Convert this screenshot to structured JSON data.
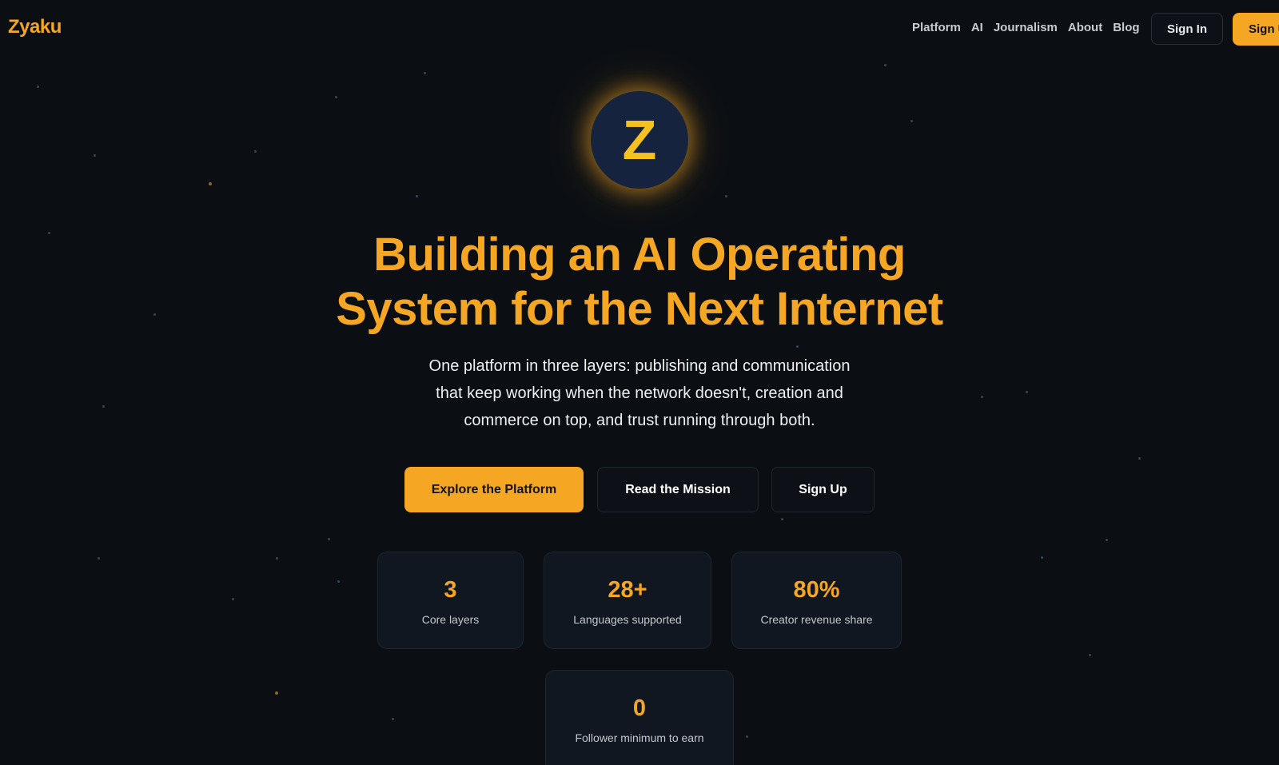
{
  "header": {
    "logo": "Zyaku",
    "nav": [
      "Platform",
      "AI",
      "Journalism",
      "About",
      "Blog"
    ],
    "sign_in": "Sign In",
    "sign_up": "Sign Up"
  },
  "hero": {
    "badge_letter": "Z",
    "title_line1": "Building an AI Operating",
    "title_line2": "System for the Next Internet",
    "subtitle_line1": "One platform in three layers: publishing and communication",
    "subtitle_line2": "that keep working when the network doesn't, creation and",
    "subtitle_line3": "commerce on top, and trust running through both."
  },
  "cta": {
    "primary": "Explore the Platform",
    "secondary": "Read the Mission",
    "tertiary": "Sign Up"
  },
  "stats": [
    {
      "value": "3",
      "label": "Core layers"
    },
    {
      "value": "28+",
      "label": "Languages supported"
    },
    {
      "value": "80%",
      "label": "Creator revenue share"
    },
    {
      "value": "0",
      "label": "Follower minimum to earn"
    }
  ],
  "colors": {
    "background": "#0b0f14",
    "accent": "#f5a623",
    "card": "#111720",
    "badge": "#15233f"
  }
}
